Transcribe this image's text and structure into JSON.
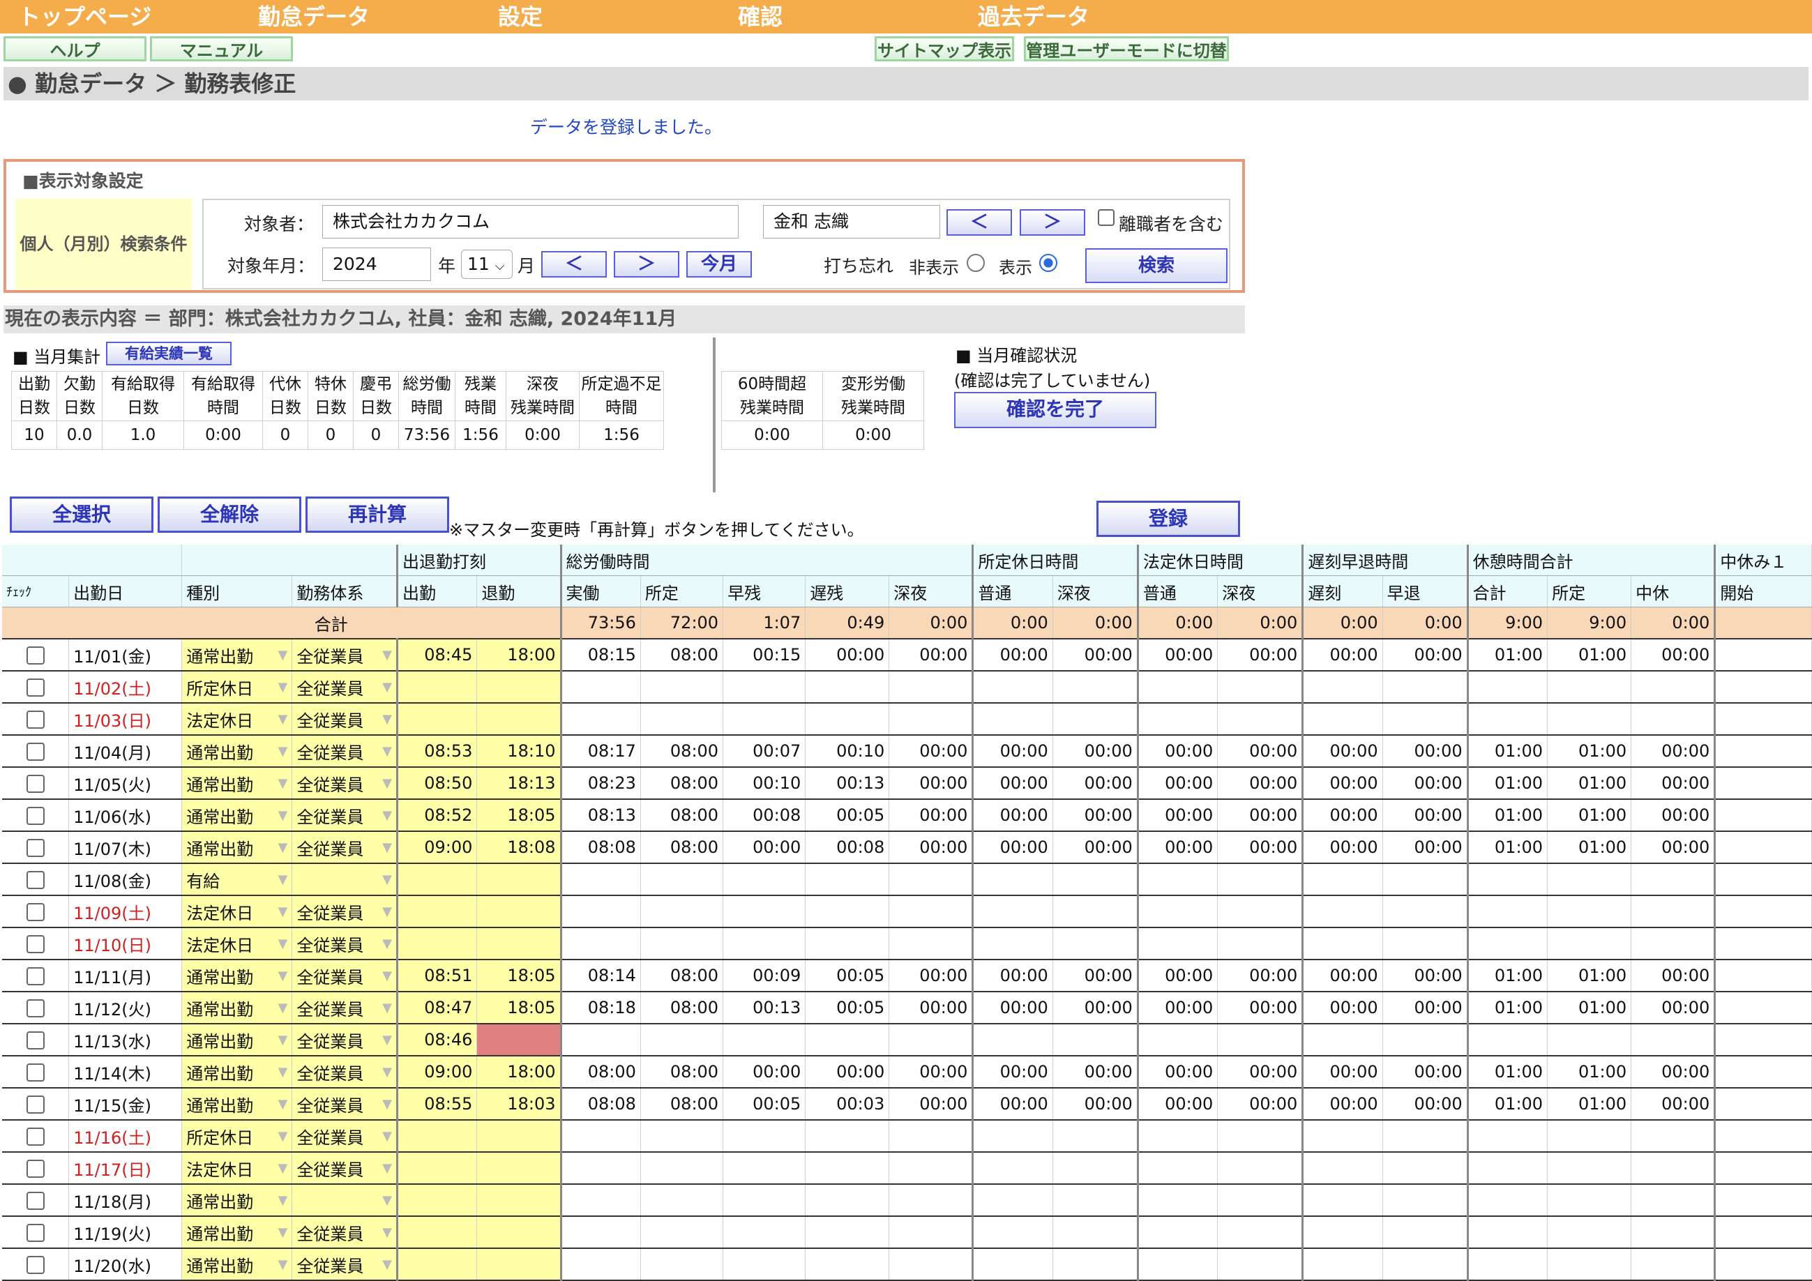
{
  "nav": {
    "items": [
      "トップページ",
      "勤怠データ",
      "設定",
      "確認",
      "過去データ"
    ]
  },
  "sub": {
    "help": "ヘルプ",
    "manual": "マニュアル",
    "sitemap": "サイトマップ表示",
    "admin": "管理ユーザーモードに切替"
  },
  "breadcrumb": "● 勤怠データ ＞ 勤務表修正",
  "message": "データを登録しました。",
  "settings": {
    "title": "■表示対象設定",
    "condition_label": "個人（月別）検索条件",
    "target_label": "対象者：",
    "company": "株式会社カカクコム",
    "employee": "金和 志織",
    "prev": "＜",
    "next": "＞",
    "include_retired": "離職者を含む",
    "year_label": "対象年月：",
    "year": "2024",
    "year_unit": "年",
    "month": "11",
    "month_unit": "月",
    "this_month": "今月",
    "forgot_label": "打ち忘れ",
    "hide": "非表示",
    "show": "表示",
    "search": "検索"
  },
  "current": "現在の表示内容 ＝ 部門：株式会社カカクコム, 社員：金和 志織, 2024年11月",
  "monthly": {
    "title": "■ 当月集計",
    "paid_list": "有給実績一覧",
    "headers": [
      [
        "出勤",
        "日数"
      ],
      [
        "欠勤",
        "日数"
      ],
      [
        "有給取得",
        "日数"
      ],
      [
        "有給取得",
        "時間"
      ],
      [
        "代休",
        "日数"
      ],
      [
        "特休",
        "日数"
      ],
      [
        "慶弔",
        "日数"
      ],
      [
        "総労働",
        "時間"
      ],
      [
        "残業",
        "時間"
      ],
      [
        "深夜",
        "残業時間"
      ],
      [
        "所定過不足",
        "時間"
      ]
    ],
    "values": [
      "10",
      "0.0",
      "1.0",
      "0:00",
      "0",
      "0",
      "0",
      "73:56",
      "1:56",
      "0:00",
      "1:56"
    ],
    "headers2": [
      [
        "60時間超",
        "残業時間"
      ],
      [
        "変形労働",
        "残業時間"
      ]
    ],
    "values2": [
      "0:00",
      "0:00"
    ]
  },
  "confirm": {
    "title": "■ 当月確認状況",
    "status": "(確認は完了していません)",
    "button": "確認を完了"
  },
  "actions": {
    "select_all": "全選択",
    "clear_all": "全解除",
    "recalc": "再計算",
    "note": "※マスター変更時「再計算」ボタンを押してください。",
    "register": "登録"
  },
  "table": {
    "groups": [
      "出退勤打刻",
      "総労働時間",
      "所定休日時間",
      "法定休日時間",
      "遅刻早退時間",
      "休憩時間合計",
      "中休み１"
    ],
    "cols": [
      "ﾁｪｯｸ",
      "出勤日",
      "種別",
      "勤務体系",
      "出勤",
      "退勤",
      "実働",
      "所定",
      "早残",
      "遅残",
      "深夜",
      "普通",
      "深夜",
      "普通",
      "深夜",
      "遅刻",
      "早退",
      "合計",
      "所定",
      "中休",
      "開始"
    ],
    "total_label": "合計",
    "totals": [
      "73:56",
      "72:00",
      "1:07",
      "0:49",
      "0:00",
      "0:00",
      "0:00",
      "0:00",
      "0:00",
      "0:00",
      "0:00",
      "9:00",
      "9:00",
      "0:00"
    ],
    "rows": [
      {
        "date": "11/01(金)",
        "wk": false,
        "type": "通常出勤",
        "sys": "全従業員",
        "in": "08:45",
        "out": "18:00",
        "v": [
          "08:15",
          "08:00",
          "00:15",
          "00:00",
          "00:00",
          "00:00",
          "00:00",
          "00:00",
          "00:00",
          "00:00",
          "00:00",
          "01:00",
          "01:00",
          "00:00"
        ]
      },
      {
        "date": "11/02(土)",
        "wk": true,
        "type": "所定休日",
        "sys": "全従業員",
        "in": "",
        "out": "",
        "v": []
      },
      {
        "date": "11/03(日)",
        "wk": true,
        "type": "法定休日",
        "sys": "全従業員",
        "in": "",
        "out": "",
        "v": []
      },
      {
        "date": "11/04(月)",
        "wk": false,
        "type": "通常出勤",
        "sys": "全従業員",
        "in": "08:53",
        "out": "18:10",
        "v": [
          "08:17",
          "08:00",
          "00:07",
          "00:10",
          "00:00",
          "00:00",
          "00:00",
          "00:00",
          "00:00",
          "00:00",
          "00:00",
          "01:00",
          "01:00",
          "00:00"
        ]
      },
      {
        "date": "11/05(火)",
        "wk": false,
        "type": "通常出勤",
        "sys": "全従業員",
        "in": "08:50",
        "out": "18:13",
        "v": [
          "08:23",
          "08:00",
          "00:10",
          "00:13",
          "00:00",
          "00:00",
          "00:00",
          "00:00",
          "00:00",
          "00:00",
          "00:00",
          "01:00",
          "01:00",
          "00:00"
        ]
      },
      {
        "date": "11/06(水)",
        "wk": false,
        "type": "通常出勤",
        "sys": "全従業員",
        "in": "08:52",
        "out": "18:05",
        "v": [
          "08:13",
          "08:00",
          "00:08",
          "00:05",
          "00:00",
          "00:00",
          "00:00",
          "00:00",
          "00:00",
          "00:00",
          "00:00",
          "01:00",
          "01:00",
          "00:00"
        ]
      },
      {
        "date": "11/07(木)",
        "wk": false,
        "type": "通常出勤",
        "sys": "全従業員",
        "in": "09:00",
        "out": "18:08",
        "v": [
          "08:08",
          "08:00",
          "00:00",
          "00:08",
          "00:00",
          "00:00",
          "00:00",
          "00:00",
          "00:00",
          "00:00",
          "00:00",
          "01:00",
          "01:00",
          "00:00"
        ]
      },
      {
        "date": "11/08(金)",
        "wk": false,
        "type": "有給",
        "sys": "",
        "in": "",
        "out": "",
        "v": []
      },
      {
        "date": "11/09(土)",
        "wk": true,
        "type": "法定休日",
        "sys": "全従業員",
        "in": "",
        "out": "",
        "v": []
      },
      {
        "date": "11/10(日)",
        "wk": true,
        "type": "法定休日",
        "sys": "全従業員",
        "in": "",
        "out": "",
        "v": []
      },
      {
        "date": "11/11(月)",
        "wk": false,
        "type": "通常出勤",
        "sys": "全従業員",
        "in": "08:51",
        "out": "18:05",
        "v": [
          "08:14",
          "08:00",
          "00:09",
          "00:05",
          "00:00",
          "00:00",
          "00:00",
          "00:00",
          "00:00",
          "00:00",
          "00:00",
          "01:00",
          "01:00",
          "00:00"
        ]
      },
      {
        "date": "11/12(火)",
        "wk": false,
        "type": "通常出勤",
        "sys": "全従業員",
        "in": "08:47",
        "out": "18:05",
        "v": [
          "08:18",
          "08:00",
          "00:13",
          "00:05",
          "00:00",
          "00:00",
          "00:00",
          "00:00",
          "00:00",
          "00:00",
          "00:00",
          "01:00",
          "01:00",
          "00:00"
        ]
      },
      {
        "date": "11/13(水)",
        "wk": false,
        "type": "通常出勤",
        "sys": "全従業員",
        "in": "08:46",
        "out": "",
        "missing": true,
        "v": []
      },
      {
        "date": "11/14(木)",
        "wk": false,
        "type": "通常出勤",
        "sys": "全従業員",
        "in": "09:00",
        "out": "18:00",
        "v": [
          "08:00",
          "08:00",
          "00:00",
          "00:00",
          "00:00",
          "00:00",
          "00:00",
          "00:00",
          "00:00",
          "00:00",
          "00:00",
          "01:00",
          "01:00",
          "00:00"
        ]
      },
      {
        "date": "11/15(金)",
        "wk": false,
        "type": "通常出勤",
        "sys": "全従業員",
        "in": "08:55",
        "out": "18:03",
        "v": [
          "08:08",
          "08:00",
          "00:05",
          "00:03",
          "00:00",
          "00:00",
          "00:00",
          "00:00",
          "00:00",
          "00:00",
          "00:00",
          "01:00",
          "01:00",
          "00:00"
        ]
      },
      {
        "date": "11/16(土)",
        "wk": true,
        "type": "所定休日",
        "sys": "全従業員",
        "in": "",
        "out": "",
        "v": []
      },
      {
        "date": "11/17(日)",
        "wk": true,
        "type": "法定休日",
        "sys": "全従業員",
        "in": "",
        "out": "",
        "v": []
      },
      {
        "date": "11/18(月)",
        "wk": false,
        "type": "通常出勤",
        "sys": "",
        "in": "",
        "out": "",
        "v": []
      },
      {
        "date": "11/19(火)",
        "wk": false,
        "type": "通常出勤",
        "sys": "全従業員",
        "in": "",
        "out": "",
        "v": []
      },
      {
        "date": "11/20(水)",
        "wk": false,
        "type": "通常出勤",
        "sys": "全従業員",
        "in": "",
        "out": "",
        "v": []
      }
    ]
  }
}
